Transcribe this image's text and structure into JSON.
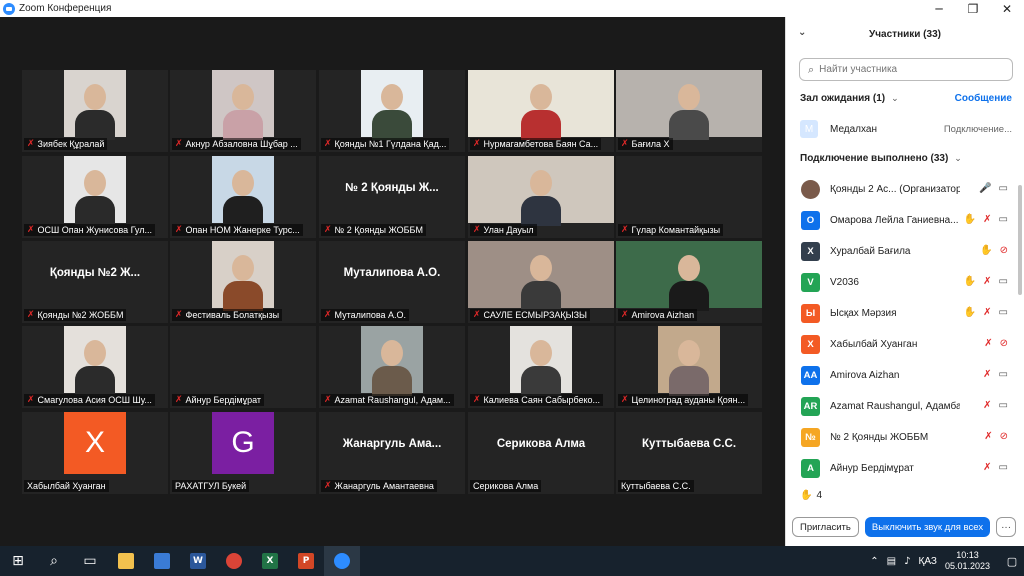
{
  "window": {
    "title": "Zoom Конференция"
  },
  "tiles": [
    {
      "name": "Зиябек Құралай",
      "kind": "photo",
      "bg": "#d9d4cf",
      "person": "#2b2b2b"
    },
    {
      "name": "Акнур Абзаловна Шұбар ...",
      "kind": "photo",
      "bg": "#cfc6c5",
      "person": "#c9a1a7"
    },
    {
      "name": "Қоянды №1   Гүлдана Қад...",
      "kind": "photo",
      "bg": "#e8eef2",
      "person": "#3a4a3a"
    },
    {
      "name": "Нурмагамбетова Баян Са...",
      "kind": "photo",
      "bg": "#e8e4d8",
      "person": "#b83030"
    },
    {
      "name": "Бағила Х",
      "kind": "photo",
      "bg": "#b7b2ad",
      "person": "#4a4a4a"
    },
    {
      "name": "ОСШ Опан Жунисова Гул...",
      "kind": "photo",
      "bg": "#e6e6e6",
      "person": "#2a2a2a"
    },
    {
      "name": "Опан НОМ Жанерке Турс...",
      "kind": "photo",
      "bg": "#c8d8e6",
      "person": "#1f1f1f"
    },
    {
      "name": "№ 2 Қоянды ЖОББМ",
      "kind": "text",
      "big": "№ 2 Қоянды Ж..."
    },
    {
      "name": "Улан Дауыл",
      "kind": "photo",
      "bg": "#cfc7bd",
      "person": "#2e3440"
    },
    {
      "name": "Гүлар Комантайқызы",
      "kind": "blank"
    },
    {
      "name": "Қоянды №2 ЖОББМ",
      "kind": "text",
      "big": "Қоянды №2 Ж..."
    },
    {
      "name": "Фестиваль Болатқызы",
      "kind": "photo",
      "bg": "#d8d0c8",
      "person": "#8a4a2a"
    },
    {
      "name": "Муталипова А.О.",
      "kind": "text",
      "big": "Муталипова А.О."
    },
    {
      "name": "САУЛЕ ЕСМЫРЗАҚЫЗЫ",
      "kind": "photo",
      "bg": "#9e8f86",
      "person": "#3a3a3a"
    },
    {
      "name": "Amirova Aizhan",
      "kind": "photo",
      "bg": "#3d6b4a",
      "person": "#1a1a1a"
    },
    {
      "name": "Смагулова Асия ОСШ Шу...",
      "kind": "photo",
      "bg": "#e4e0db",
      "person": "#2b2b2b"
    },
    {
      "name": "Айнур Бердімұрат",
      "kind": "blank"
    },
    {
      "name": "Azamat Raushangul, Адам...",
      "kind": "photo",
      "bg": "#9aa3a3",
      "person": "#6b5b4b"
    },
    {
      "name": "Калиева Саян Сабырбеко...",
      "kind": "photo",
      "bg": "#e4e2de",
      "person": "#3a3a3a"
    },
    {
      "name": "Целиноград ауданы Қоян...",
      "kind": "photo",
      "bg": "#c2a98c",
      "person": "#7a6a6a"
    },
    {
      "name": "Хабылбай Хуанган",
      "kind": "letter",
      "letter": "X",
      "color": "#f35a24"
    },
    {
      "name": "РАХАТГУЛ Букей",
      "kind": "letter",
      "letter": "G",
      "color": "#7b1fa2"
    },
    {
      "name": "Жанаргуль Амантаевна",
      "kind": "text",
      "big": "Жанаргуль Ама..."
    },
    {
      "name": "Серикова Алма",
      "kind": "text",
      "big": "Серикова Алма"
    },
    {
      "name": "Куттыбаева С.С.",
      "kind": "text",
      "big": "Куттыбаева С.С."
    }
  ],
  "panel": {
    "title": "Участники (33)",
    "search_placeholder": "Найти участника",
    "waiting_title": "Зал ожидания (1)",
    "message_label": "Сообщение",
    "waiting": {
      "initial": "М",
      "name": "Медалхан",
      "status": "Подключение..."
    },
    "connected_title": "Подключение выполнено (33)",
    "participants": [
      {
        "initial": "",
        "name": "Қоянды 2 Ас... (Организатор, я)",
        "color": "#7a5a4a",
        "hand": false,
        "mic": "on",
        "cam": "on",
        "photo": true
      },
      {
        "initial": "О",
        "name": "Омарова Лейла Ганиевна...",
        "color": "#0e71eb",
        "hand": true,
        "mic": "off",
        "cam": "on"
      },
      {
        "initial": "Х",
        "name": "Хуралбай Бағила",
        "color": "#333f4d",
        "hand": true,
        "mic": "none",
        "cam": "off"
      },
      {
        "initial": "V",
        "name": "V2036",
        "color": "#23a455",
        "hand": true,
        "mic": "off",
        "cam": "on"
      },
      {
        "initial": "Ы",
        "name": "Ысқах Мәрзия",
        "color": "#f35a24",
        "hand": true,
        "mic": "off",
        "cam": "on"
      },
      {
        "initial": "Х",
        "name": "Хабылбай Хуанган",
        "color": "#f35a24",
        "hand": false,
        "mic": "off",
        "cam": "off"
      },
      {
        "initial": "AA",
        "name": "Amirova Aizhan",
        "color": "#0e71eb",
        "hand": false,
        "mic": "off",
        "cam": "on"
      },
      {
        "initial": "AR",
        "name": "Azamat Raushangul, Адамбаев...",
        "color": "#23a455",
        "hand": false,
        "mic": "off",
        "cam": "on"
      },
      {
        "initial": "№",
        "name": "№ 2 Қоянды ЖОББМ",
        "color": "#f5a623",
        "hand": false,
        "mic": "off",
        "cam": "off"
      },
      {
        "initial": "А",
        "name": "Айнур Бердімұрат",
        "color": "#23a455",
        "hand": false,
        "mic": "off",
        "cam": "on"
      }
    ],
    "raised_count": "4",
    "invite_label": "Пригласить",
    "mute_all_label": "Выключить звук для всех",
    "more_label": "···"
  },
  "taskbar": {
    "lang": "ҚАЗ",
    "time": "10:13",
    "date": "05.01.2023",
    "apps": [
      "W",
      "X",
      "P"
    ]
  }
}
